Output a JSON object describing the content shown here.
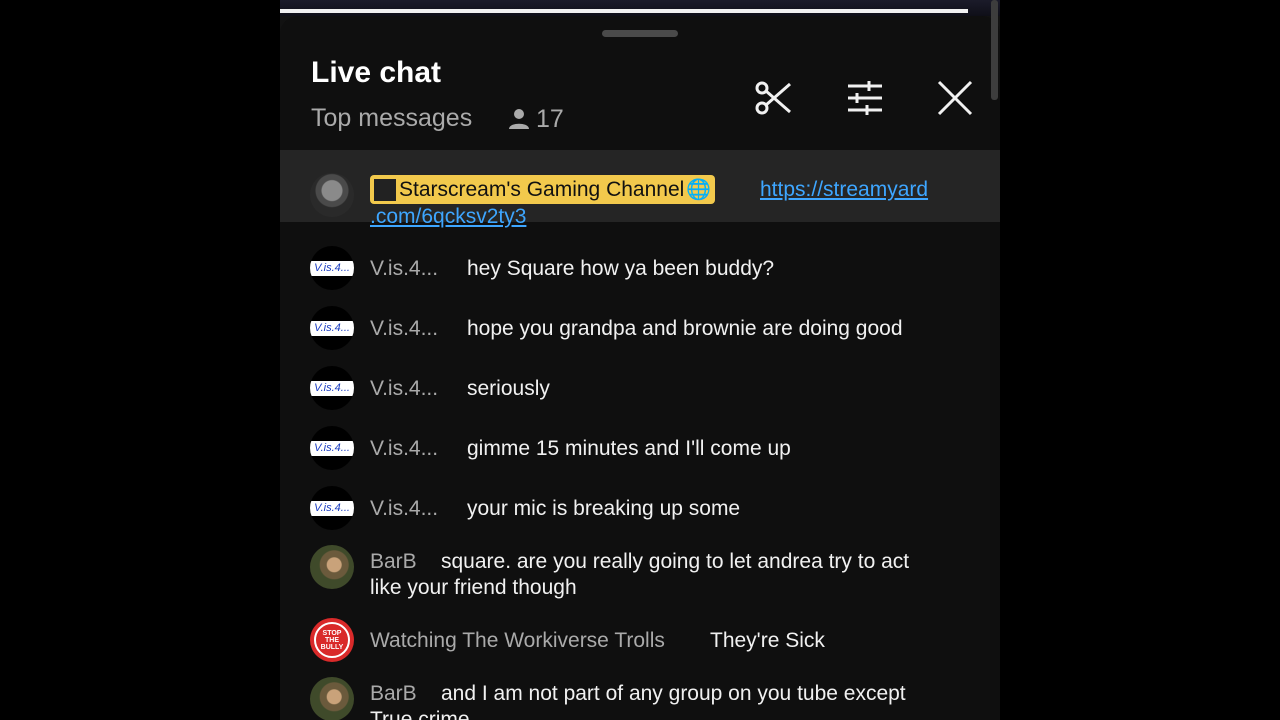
{
  "header": {
    "title": "Live chat",
    "subtitle": "Top messages",
    "viewer_count": "17"
  },
  "pinned": {
    "channel": "Starscream's Gaming Channel",
    "link_line1": "https://streamyard",
    "link_line2": ".com/6qcksv2ty3"
  },
  "messages": [
    {
      "avatar_text": "V.is.4...",
      "author": "V.is.4...",
      "text": "hey Square how ya been buddy?"
    },
    {
      "avatar_text": "V.is.4...",
      "author": "V.is.4...",
      "text": "hope you grandpa and brownie are doing good"
    },
    {
      "avatar_text": "V.is.4...",
      "author": "V.is.4...",
      "text": "seriously"
    },
    {
      "avatar_text": "V.is.4...",
      "author": "V.is.4...",
      "text": "gimme 15 minutes and I'll come up"
    },
    {
      "avatar_text": "V.is.4...",
      "author": "V.is.4...",
      "text": "your mic is breaking up some"
    },
    {
      "author": "BarB",
      "text_line1": "square. are you really going to let andrea try to act",
      "text_line2": "like your friend though"
    },
    {
      "author": "Watching The Workiverse Trolls",
      "text": "They're Sick",
      "avatar_text": "STOP THE BULLY"
    },
    {
      "author": "BarB",
      "text_line1": "and I am not part of any group on you tube except",
      "text_line2": "True crime"
    }
  ],
  "colors": {
    "owner_badge": "#f2c94c",
    "link": "#3ea6ff",
    "background": "#0f0f0f"
  }
}
